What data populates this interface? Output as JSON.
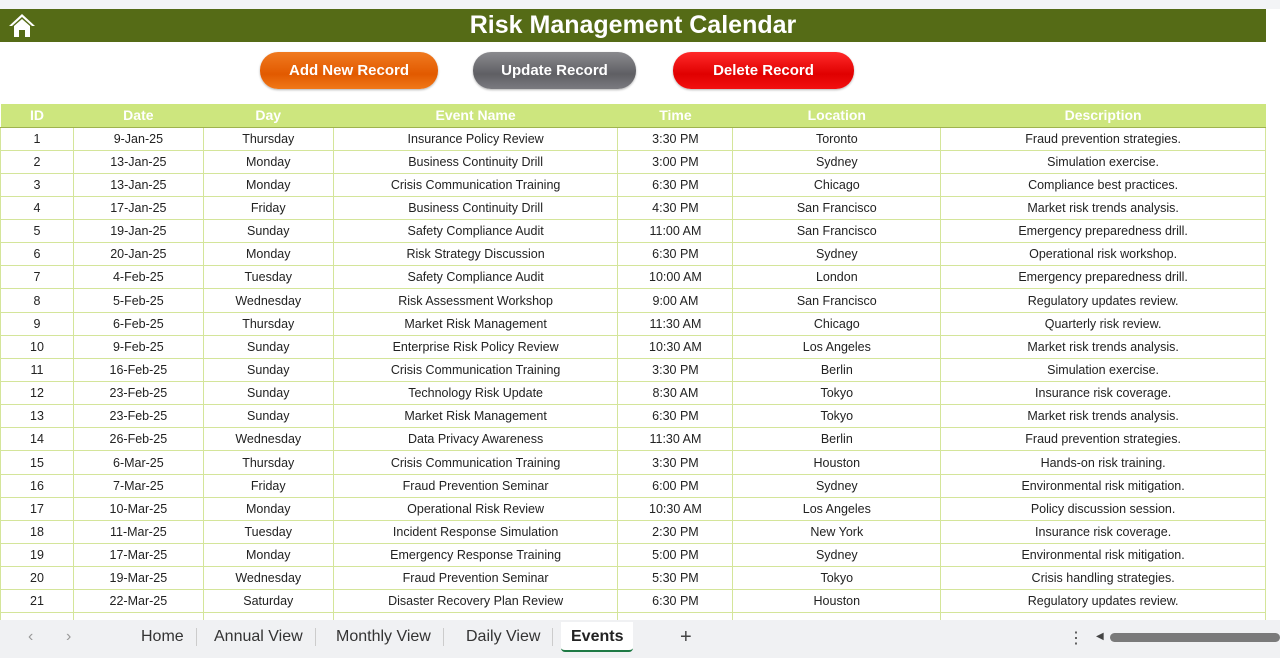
{
  "title": "Risk Management Calendar",
  "buttons": {
    "add": "Add New Record",
    "update": "Update Record",
    "delete": "Delete Record"
  },
  "colors": {
    "title_bar": "#556b16",
    "header": "#cde67e",
    "add": "#e25a00",
    "update": "#5f5f64",
    "delete": "#e00000"
  },
  "columns": [
    "ID",
    "Date",
    "Day",
    "Event Name",
    "Time",
    "Location",
    "Description"
  ],
  "rows": [
    [
      "1",
      "9-Jan-25",
      "Thursday",
      "Insurance Policy Review",
      "3:30 PM",
      "Toronto",
      "Fraud prevention strategies."
    ],
    [
      "2",
      "13-Jan-25",
      "Monday",
      "Business Continuity Drill",
      "3:00 PM",
      "Sydney",
      "Simulation exercise."
    ],
    [
      "3",
      "13-Jan-25",
      "Monday",
      "Crisis Communication Training",
      "6:30 PM",
      "Chicago",
      "Compliance best practices."
    ],
    [
      "4",
      "17-Jan-25",
      "Friday",
      "Business Continuity Drill",
      "4:30 PM",
      "San Francisco",
      "Market risk trends analysis."
    ],
    [
      "5",
      "19-Jan-25",
      "Sunday",
      "Safety Compliance Audit",
      "11:00 AM",
      "San Francisco",
      "Emergency preparedness drill."
    ],
    [
      "6",
      "20-Jan-25",
      "Monday",
      "Risk Strategy Discussion",
      "6:30 PM",
      "Sydney",
      "Operational risk workshop."
    ],
    [
      "7",
      "4-Feb-25",
      "Tuesday",
      "Safety Compliance Audit",
      "10:00 AM",
      "London",
      "Emergency preparedness drill."
    ],
    [
      "8",
      "5-Feb-25",
      "Wednesday",
      "Risk Assessment Workshop",
      "9:00 AM",
      "San Francisco",
      "Regulatory updates review."
    ],
    [
      "9",
      "6-Feb-25",
      "Thursday",
      "Market Risk Management",
      "11:30 AM",
      "Chicago",
      "Quarterly risk review."
    ],
    [
      "10",
      "9-Feb-25",
      "Sunday",
      "Enterprise Risk Policy Review",
      "10:30 AM",
      "Los Angeles",
      "Market risk trends analysis."
    ],
    [
      "11",
      "16-Feb-25",
      "Sunday",
      "Crisis Communication Training",
      "3:30 PM",
      "Berlin",
      "Simulation exercise."
    ],
    [
      "12",
      "23-Feb-25",
      "Sunday",
      "Technology Risk Update",
      "8:30 AM",
      "Tokyo",
      "Insurance risk coverage."
    ],
    [
      "13",
      "23-Feb-25",
      "Sunday",
      "Market Risk Management",
      "6:30 PM",
      "Tokyo",
      "Market risk trends analysis."
    ],
    [
      "14",
      "26-Feb-25",
      "Wednesday",
      "Data Privacy Awareness",
      "11:30 AM",
      "Berlin",
      "Fraud prevention strategies."
    ],
    [
      "15",
      "6-Mar-25",
      "Thursday",
      "Crisis Communication Training",
      "3:30 PM",
      "Houston",
      "Hands-on risk training."
    ],
    [
      "16",
      "7-Mar-25",
      "Friday",
      "Fraud Prevention Seminar",
      "6:00 PM",
      "Sydney",
      "Environmental risk mitigation."
    ],
    [
      "17",
      "10-Mar-25",
      "Monday",
      "Operational Risk Review",
      "10:30 AM",
      "Los Angeles",
      "Policy discussion session."
    ],
    [
      "18",
      "11-Mar-25",
      "Tuesday",
      "Incident Response Simulation",
      "2:30 PM",
      "New York",
      "Insurance risk coverage."
    ],
    [
      "19",
      "17-Mar-25",
      "Monday",
      "Emergency Response Training",
      "5:00 PM",
      "Sydney",
      "Environmental risk mitigation."
    ],
    [
      "20",
      "19-Mar-25",
      "Wednesday",
      "Fraud Prevention Seminar",
      "5:30 PM",
      "Tokyo",
      "Crisis handling strategies."
    ],
    [
      "21",
      "22-Mar-25",
      "Saturday",
      "Disaster Recovery Plan Review",
      "6:30 PM",
      "Houston",
      "Regulatory updates review."
    ]
  ],
  "sheets": [
    "Home",
    "Annual View",
    "Monthly View",
    "Daily View",
    "Events"
  ],
  "active_sheet": "Events"
}
